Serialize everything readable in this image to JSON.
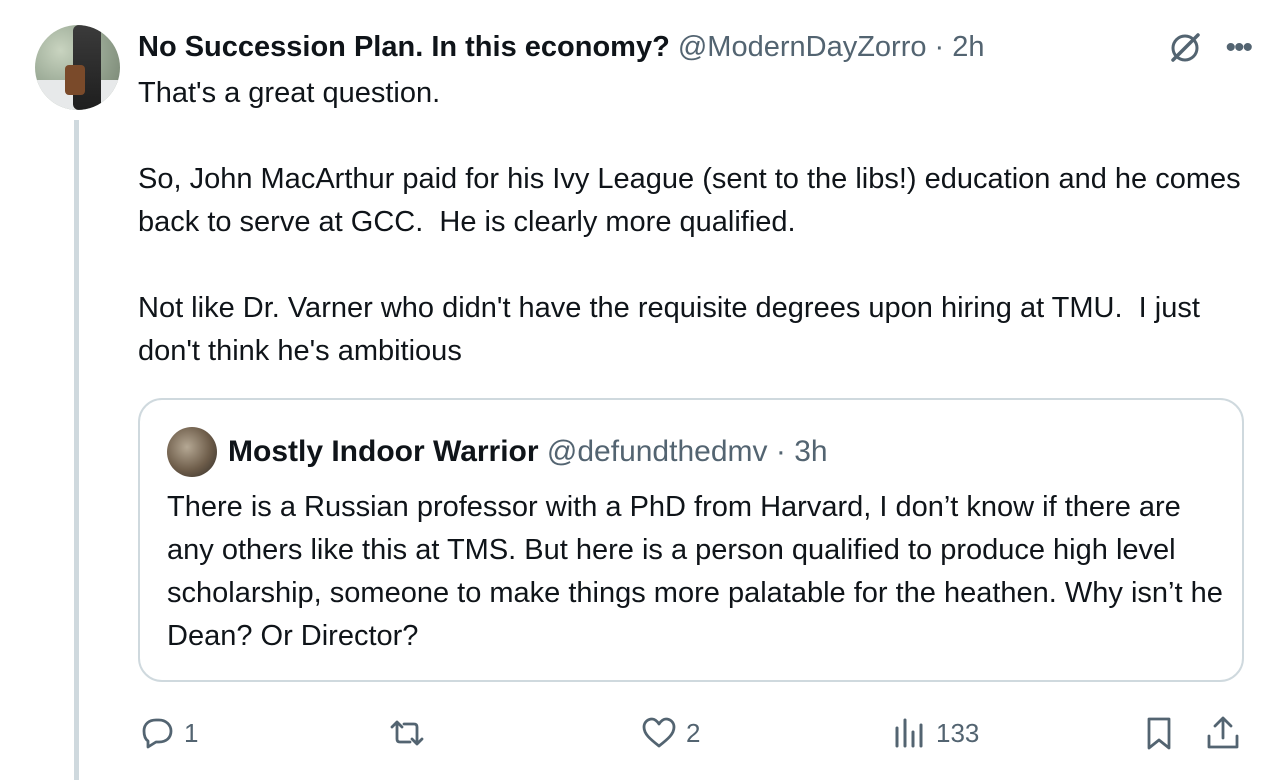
{
  "tweet": {
    "author_name": "No Succession Plan. In this economy?",
    "author_handle": "@ModernDayZorro",
    "separator": "·",
    "time": "2h",
    "body": "That's a great question.\n\nSo, John MacArthur paid for his Ivy League (sent to the libs!) education and he comes back to serve at GCC.  He is clearly more qualified.\n\nNot like Dr. Varner who didn't have the requisite degrees upon hiring at TMU.  I just don't think he's ambitious"
  },
  "quote": {
    "author_name": "Mostly Indoor Warrior",
    "author_handle": "@defundthedmv",
    "separator": "·",
    "time": "3h",
    "body": "There is a Russian professor with a PhD from Harvard, I don’t know if there are any others like this at TMS. But here is a person qualified to produce high level scholarship, someone to make things more palatable for the heathen. Why isn’t he Dean? Or Director?"
  },
  "actions": {
    "reply_count": "1",
    "repost_count": "",
    "like_count": "2",
    "views_count": "133"
  },
  "icons": {
    "top_right": [
      "grok-icon",
      "more-icon"
    ],
    "actions": [
      "reply-icon",
      "repost-icon",
      "like-icon",
      "views-icon",
      "bookmark-icon",
      "share-icon"
    ]
  },
  "colors": {
    "text": "#0f1419",
    "secondary": "#536471",
    "border": "#cfd9de"
  }
}
